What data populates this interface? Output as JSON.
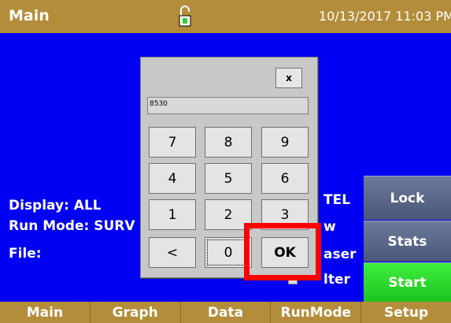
{
  "titlebar": {
    "title": "Main",
    "datetime": "10/13/2017 11:03 PM",
    "status_icon": "unlocked-padlock-icon"
  },
  "info": {
    "display": "Display: ALL",
    "run_mode": "Run Mode: SURV",
    "file": "File:"
  },
  "side_partial": {
    "tel": "TEL",
    "w": "w",
    "aser": "aser",
    "lter": "lter"
  },
  "side_buttons": {
    "lock": "Lock",
    "stats": "Stats",
    "start": "Start"
  },
  "tabs": [
    "Main",
    "Graph",
    "Data",
    "RunMode",
    "Setup"
  ],
  "keypad": {
    "close_label": "x",
    "entry_value": "8530",
    "keys": [
      "7",
      "8",
      "9",
      "4",
      "5",
      "6",
      "1",
      "2",
      "3",
      "<",
      "0",
      "OK"
    ]
  },
  "colors": {
    "background": "#0000f2",
    "bar": "#b38d3a",
    "start": "#22cc22",
    "side_button": "#5a6688",
    "highlight": "#ff0000"
  }
}
